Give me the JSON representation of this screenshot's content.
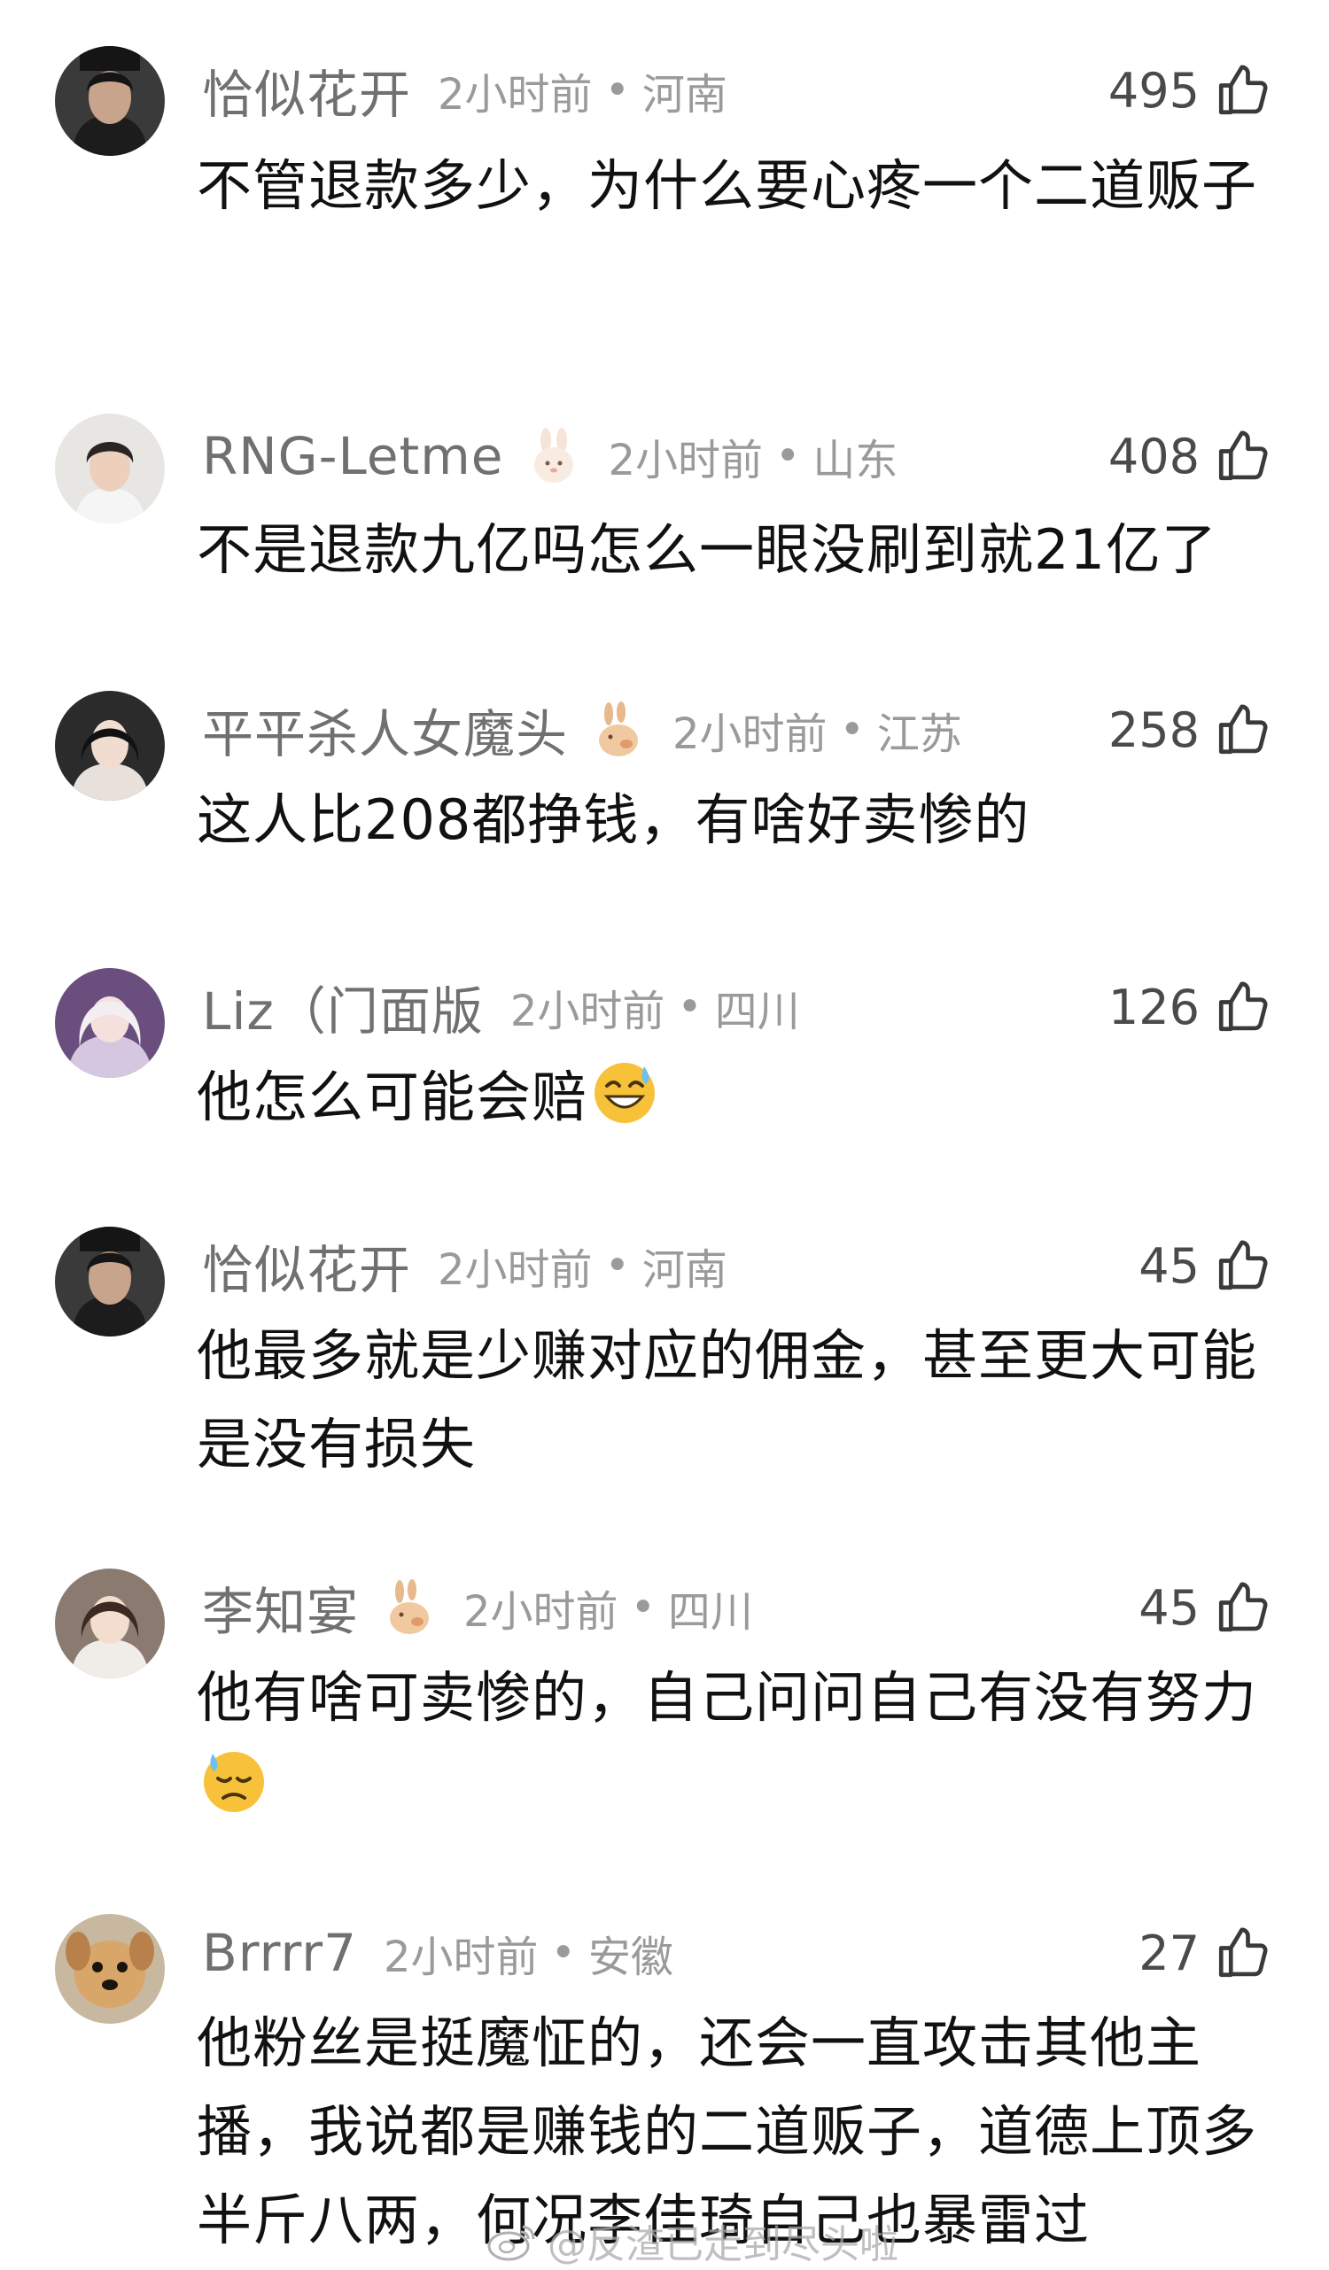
{
  "comments": [
    {
      "username": "恰似花开",
      "time": "2小时前",
      "location": "河南",
      "likes": "495",
      "text": "不管退款多少，为什么要心疼一个二道贩子"
    },
    {
      "username": "RNG-Letme",
      "time": "2小时前",
      "location": "山东",
      "likes": "408",
      "text": "不是退款九亿吗怎么一眼没刷到就21亿了"
    },
    {
      "username": "平平杀人女魔头",
      "time": "2小时前",
      "location": "江苏",
      "likes": "258",
      "text": "这人比208都挣钱，有啥好卖惨的"
    },
    {
      "username": "Liz（门面版",
      "time": "2小时前",
      "location": "四川",
      "likes": "126",
      "text": "他怎么可能会赔"
    },
    {
      "username": "恰似花开",
      "time": "2小时前",
      "location": "河南",
      "likes": "45",
      "text": "他最多就是少赚对应的佣金，甚至更大可能是没有损失"
    },
    {
      "username": "李知宴",
      "time": "2小时前",
      "location": "四川",
      "likes": "45",
      "text": "他有啥可卖惨的，自己问问自己有没有努力"
    },
    {
      "username": "Brrrr7",
      "time": "2小时前",
      "location": "安徽",
      "likes": "27",
      "text": "他粉丝是挺魔怔的，还会一直攻击其他主播，我说都是赚钱的二道贩子，道德上顶多半斤八两，何况李佳琦自己也暴雷过"
    }
  ],
  "separator": "•",
  "watermark": "@反渣已走到尽头啦",
  "icons": {
    "like": "thumbs-up-icon",
    "badge": "rabbit-badge-icon",
    "emoji_sweat_smile": "sweat-smile-emoji",
    "emoji_downcast_sweat": "downcast-sweat-emoji",
    "watermark_logo": "weibo-logo-icon"
  },
  "colors": {
    "username": "#707070",
    "meta": "#9a9a9a",
    "text": "#111111",
    "likes": "#4a4a4a"
  }
}
